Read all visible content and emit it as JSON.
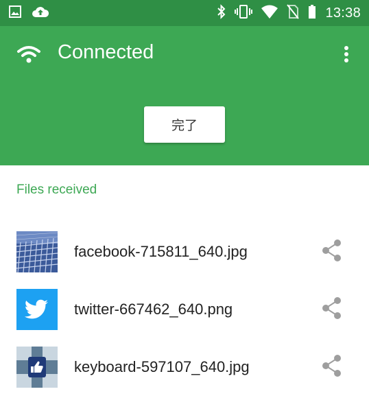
{
  "status_bar": {
    "time": "13:38",
    "left_icons": [
      "image-icon",
      "cloud-upload-icon"
    ],
    "right_icons": [
      "bluetooth-icon",
      "vibrate-icon",
      "wifi-signal-icon",
      "no-sim-icon",
      "battery-icon"
    ]
  },
  "header": {
    "title": "Connected",
    "done_label": "完了"
  },
  "files": {
    "section_title": "Files received",
    "items": [
      {
        "name": "facebook-715811_640.jpg",
        "thumb": "facebook-thumbnail"
      },
      {
        "name": "twitter-667462_640.png",
        "thumb": "twitter-thumbnail"
      },
      {
        "name": "keyboard-597107_640.jpg",
        "thumb": "keyboard-thumbnail"
      }
    ]
  },
  "colors": {
    "status_bar": "#2f8f45",
    "header": "#3da854",
    "accent": "#3da854",
    "share_icon": "#9e9e9e",
    "twitter_blue": "#1da1f2"
  }
}
